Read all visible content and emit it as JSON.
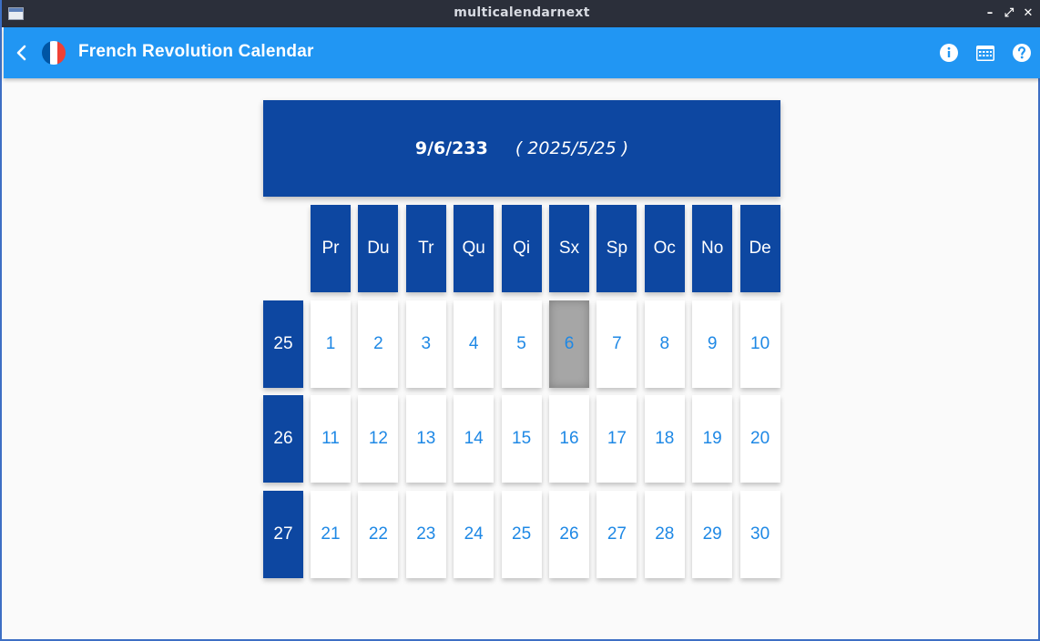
{
  "window": {
    "title": "multicalendarnext",
    "controls": {
      "minimize": "–",
      "maximize": "⤢",
      "close": "✕"
    }
  },
  "appbar": {
    "title": "French Revolution Calendar",
    "back_icon": "arrow-back-icon",
    "flag_icon": "france-flag-icon",
    "flag_colors": [
      "#0055a4",
      "#ffffff",
      "#ef4135"
    ],
    "actions": [
      "info-icon",
      "calendar-today-icon",
      "help-icon"
    ]
  },
  "calendar": {
    "header": {
      "revolutionary_date": "9/6/233",
      "gregorian_date": "( 2025/5/25 )"
    },
    "weekdays": [
      "Pr",
      "Du",
      "Tr",
      "Qu",
      "Qi",
      "Sx",
      "Sp",
      "Oc",
      "No",
      "De"
    ],
    "weeks": [
      {
        "label": "25",
        "days": [
          "1",
          "2",
          "3",
          "4",
          "5",
          "6",
          "7",
          "8",
          "9",
          "10"
        ]
      },
      {
        "label": "26",
        "days": [
          "11",
          "12",
          "13",
          "14",
          "15",
          "16",
          "17",
          "18",
          "19",
          "20"
        ]
      },
      {
        "label": "27",
        "days": [
          "21",
          "22",
          "23",
          "24",
          "25",
          "26",
          "27",
          "28",
          "29",
          "30"
        ]
      }
    ],
    "selected_day": "6"
  },
  "colors": {
    "appbar": "#2196f3",
    "primary_dark": "#0d47a1",
    "day_text": "#1e88e5",
    "selected_bg": "#a6a6a6"
  }
}
